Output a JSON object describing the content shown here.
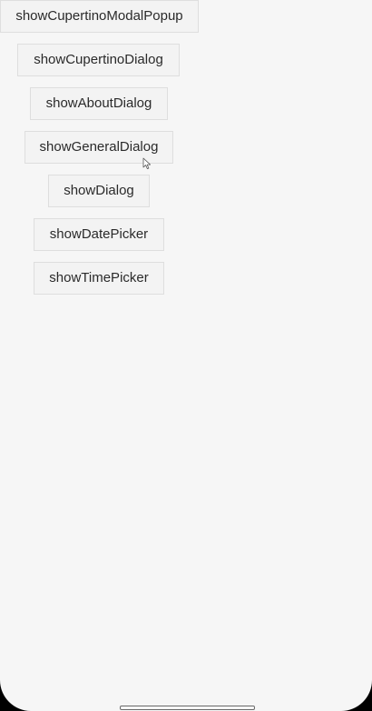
{
  "buttons": {
    "cupertino_modal_popup": "showCupertinoModalPopup",
    "cupertino_dialog": "showCupertinoDialog",
    "about_dialog": "showAboutDialog",
    "general_dialog": "showGeneralDialog",
    "dialog": "showDialog",
    "date_picker": "showDatePicker",
    "time_picker": "showTimePicker"
  },
  "colors": {
    "background": "#f6f6f6",
    "button_background": "#f3f3f3",
    "button_border": "#dedede",
    "text": "#2a2a2a"
  },
  "icons": {
    "pointer": "mouse-pointer-icon"
  }
}
